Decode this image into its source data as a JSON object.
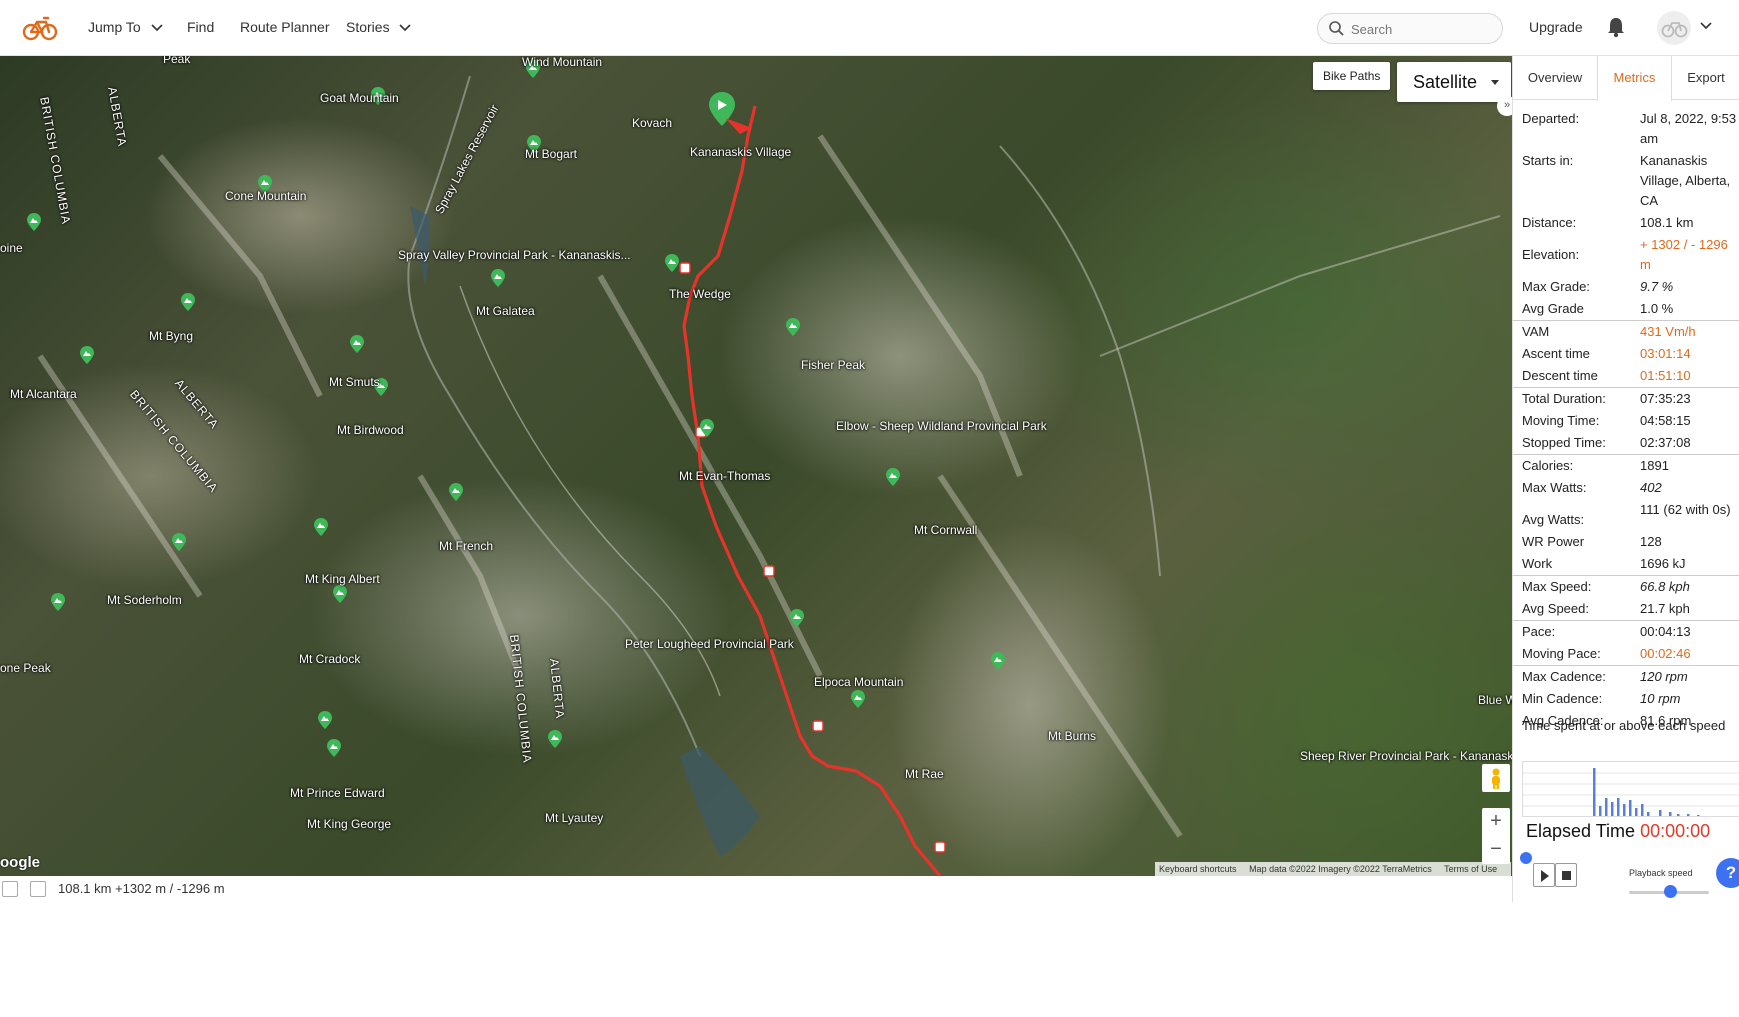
{
  "nav": {
    "jump_to": "Jump To",
    "find": "Find",
    "route_planner": "Route Planner",
    "stories": "Stories",
    "search_placeholder": "Search",
    "upgrade": "Upgrade"
  },
  "map": {
    "bike_paths": "Bike Paths",
    "map_type": "Satellite",
    "google_mark": "oogle",
    "attribution": {
      "keyboard": "Keyboard shortcuts",
      "data": "Map data ©2022 Imagery ©2022 TerraMetrics",
      "terms": "Terms of Use"
    },
    "labels": {
      "peak_top": "Peak",
      "british_columbia_1": "BRITISH COLUMBIA",
      "alberta_1": "ALBERTA",
      "wind_mountain": "Wind Mountain",
      "goat_mountain": "Goat Mountain",
      "kovach": "Kovach",
      "mt_bogart": "Mt Bogart",
      "kananaskis_village": "Kananaskis Village",
      "spray_lakes_reservoir": "Spray Lakes Reservoir",
      "cone_mountain": "Cone Mountain",
      "spray_valley_park": "Spray Valley Provincial Park - Kananaskis...",
      "pine": "oine",
      "mt_galatea": "Mt Galatea",
      "the_wedge": "The Wedge",
      "mt_byng": "Mt Byng",
      "fisher_peak": "Fisher Peak",
      "mt_smuts": "Mt Smuts",
      "mt_alcantara": "Mt Alcantara",
      "alberta_2": "ALBERTA",
      "british_columbia_2": "BRITISH COLUMBIA",
      "mt_birdwood": "Mt Birdwood",
      "elbow_sheep": "Elbow - Sheep Wildland Provincial Park",
      "mt_evan_thomas": "Mt Evan-Thomas",
      "mt_cornwall": "Mt Cornwall",
      "mt_french": "Mt French",
      "mt_king_albert": "Mt King Albert",
      "mt_soderholm": "Mt Soderholm",
      "peter_lougheed": "Peter Lougheed Provincial Park",
      "british_columbia_3": "BRITISH COLUMBIA",
      "alberta_3": "ALBERTA",
      "mt_cradock": "Mt Cradock",
      "one_peak": "one Peak",
      "elpoca_mountain": "Elpoca Mountain",
      "blue_wild_provi": "Blue Wild Provi Pa",
      "mt_burns": "Mt Burns",
      "sheep_river": "Sheep River Provincial Park - Kananaskis...",
      "mt_rae": "Mt Rae",
      "mt_prince_edward": "Mt Prince Edward",
      "mt_king_george": "Mt King George",
      "mt_lyautey": "Mt Lyautey"
    }
  },
  "status": {
    "route_summary": "108.1 km +1302 m / -1296 m"
  },
  "panel": {
    "tabs": [
      "Overview",
      "Metrics",
      "Export"
    ],
    "active_tab": "Metrics",
    "metrics": [
      {
        "label": "Departed:",
        "value": "Jul 8, 2022, 9:53 am"
      },
      {
        "label": "Starts in:",
        "value": "Kananaskis Village, Alberta, CA"
      },
      {
        "label": "Distance:",
        "value": "108.1 km"
      },
      {
        "label": "Elevation:",
        "value": "+ 1302 / - 1296 m"
      },
      {
        "label": "Max Grade:",
        "value": "9.7 %"
      },
      {
        "label": "Avg Grade",
        "value": "1.0 %"
      },
      {
        "label": "VAM",
        "value": "431 Vm/h"
      },
      {
        "label": "Ascent time",
        "value": "03:01:14"
      },
      {
        "label": "Descent time",
        "value": "01:51:10"
      },
      {
        "label": "Total Duration:",
        "value": "07:35:23"
      },
      {
        "label": "Moving Time:",
        "value": "04:58:15"
      },
      {
        "label": "Stopped Time:",
        "value": "02:37:08"
      },
      {
        "label": "Calories:",
        "value": "1891"
      },
      {
        "label": "Max Watts:",
        "value": "402"
      },
      {
        "label": "Avg Watts:",
        "value": "111 (62 with 0s)"
      },
      {
        "label": "WR Power",
        "value": "128"
      },
      {
        "label": "Work",
        "value": "1696 kJ"
      },
      {
        "label": "Max Speed:",
        "value": "66.8 kph"
      },
      {
        "label": "Avg Speed:",
        "value": "21.7 kph"
      },
      {
        "label": "Pace:",
        "value": "00:04:13"
      },
      {
        "label": "Moving Pace:",
        "value": "00:02:46"
      },
      {
        "label": "Max Cadence:",
        "value": "120 rpm"
      },
      {
        "label": "Min Cadence:",
        "value": "10 rpm"
      },
      {
        "label": "Avg Cadence:",
        "value": "81.6 rpm"
      }
    ],
    "speed_caption": "Time spent at or above each speed",
    "elapsed_label": "Elapsed Time",
    "elapsed_value": "00:00:00",
    "playback_speed": "Playback speed",
    "help": "?"
  },
  "colors": {
    "accent_orange": "#e06a1b",
    "route_red": "#e8332a",
    "playback_blue": "#3c72f1",
    "peak_pin_green": "#3fb85a"
  }
}
